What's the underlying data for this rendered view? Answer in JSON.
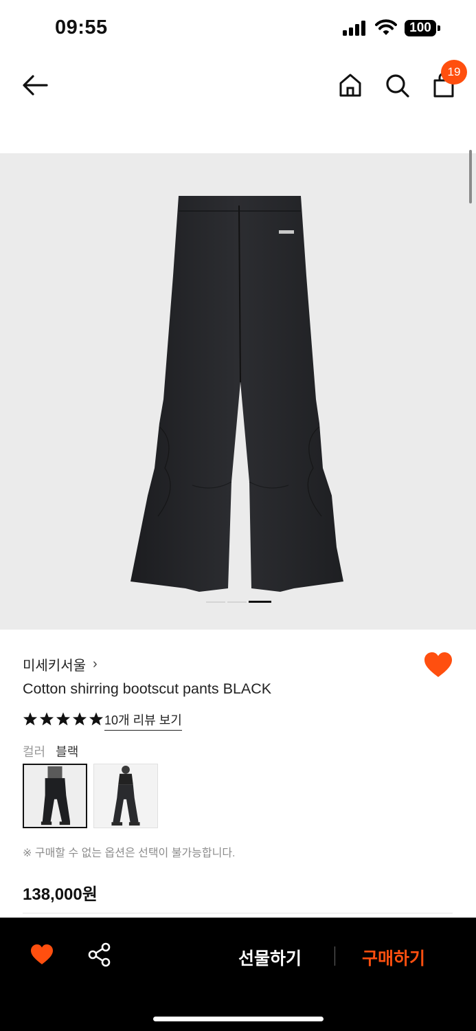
{
  "status": {
    "time": "09:55",
    "battery": "100"
  },
  "nav": {
    "cart_count": "19",
    "icons": [
      "back-arrow-icon",
      "home-icon",
      "search-icon",
      "shopping-bag-icon"
    ]
  },
  "gallery": {
    "total_images": 3,
    "current_index": 3
  },
  "product": {
    "brand": "미세키서울",
    "brand_chevron": "›",
    "title": "Cotton shirring bootscut pants BLACK",
    "rating": 5,
    "review_link": "10개 리뷰 보기",
    "color_label": "컬러",
    "color_value": "블랙",
    "notice": "※ 구매할 수 없는 옵션은 선택이 불가능합니다.",
    "price": "138,000원"
  },
  "actions": {
    "gift_label": "선물하기",
    "buy_label": "구매하기"
  },
  "colors": {
    "accent": "#ff4f0f",
    "bar_bg": "#000000",
    "image_bg": "#ebebeb"
  }
}
